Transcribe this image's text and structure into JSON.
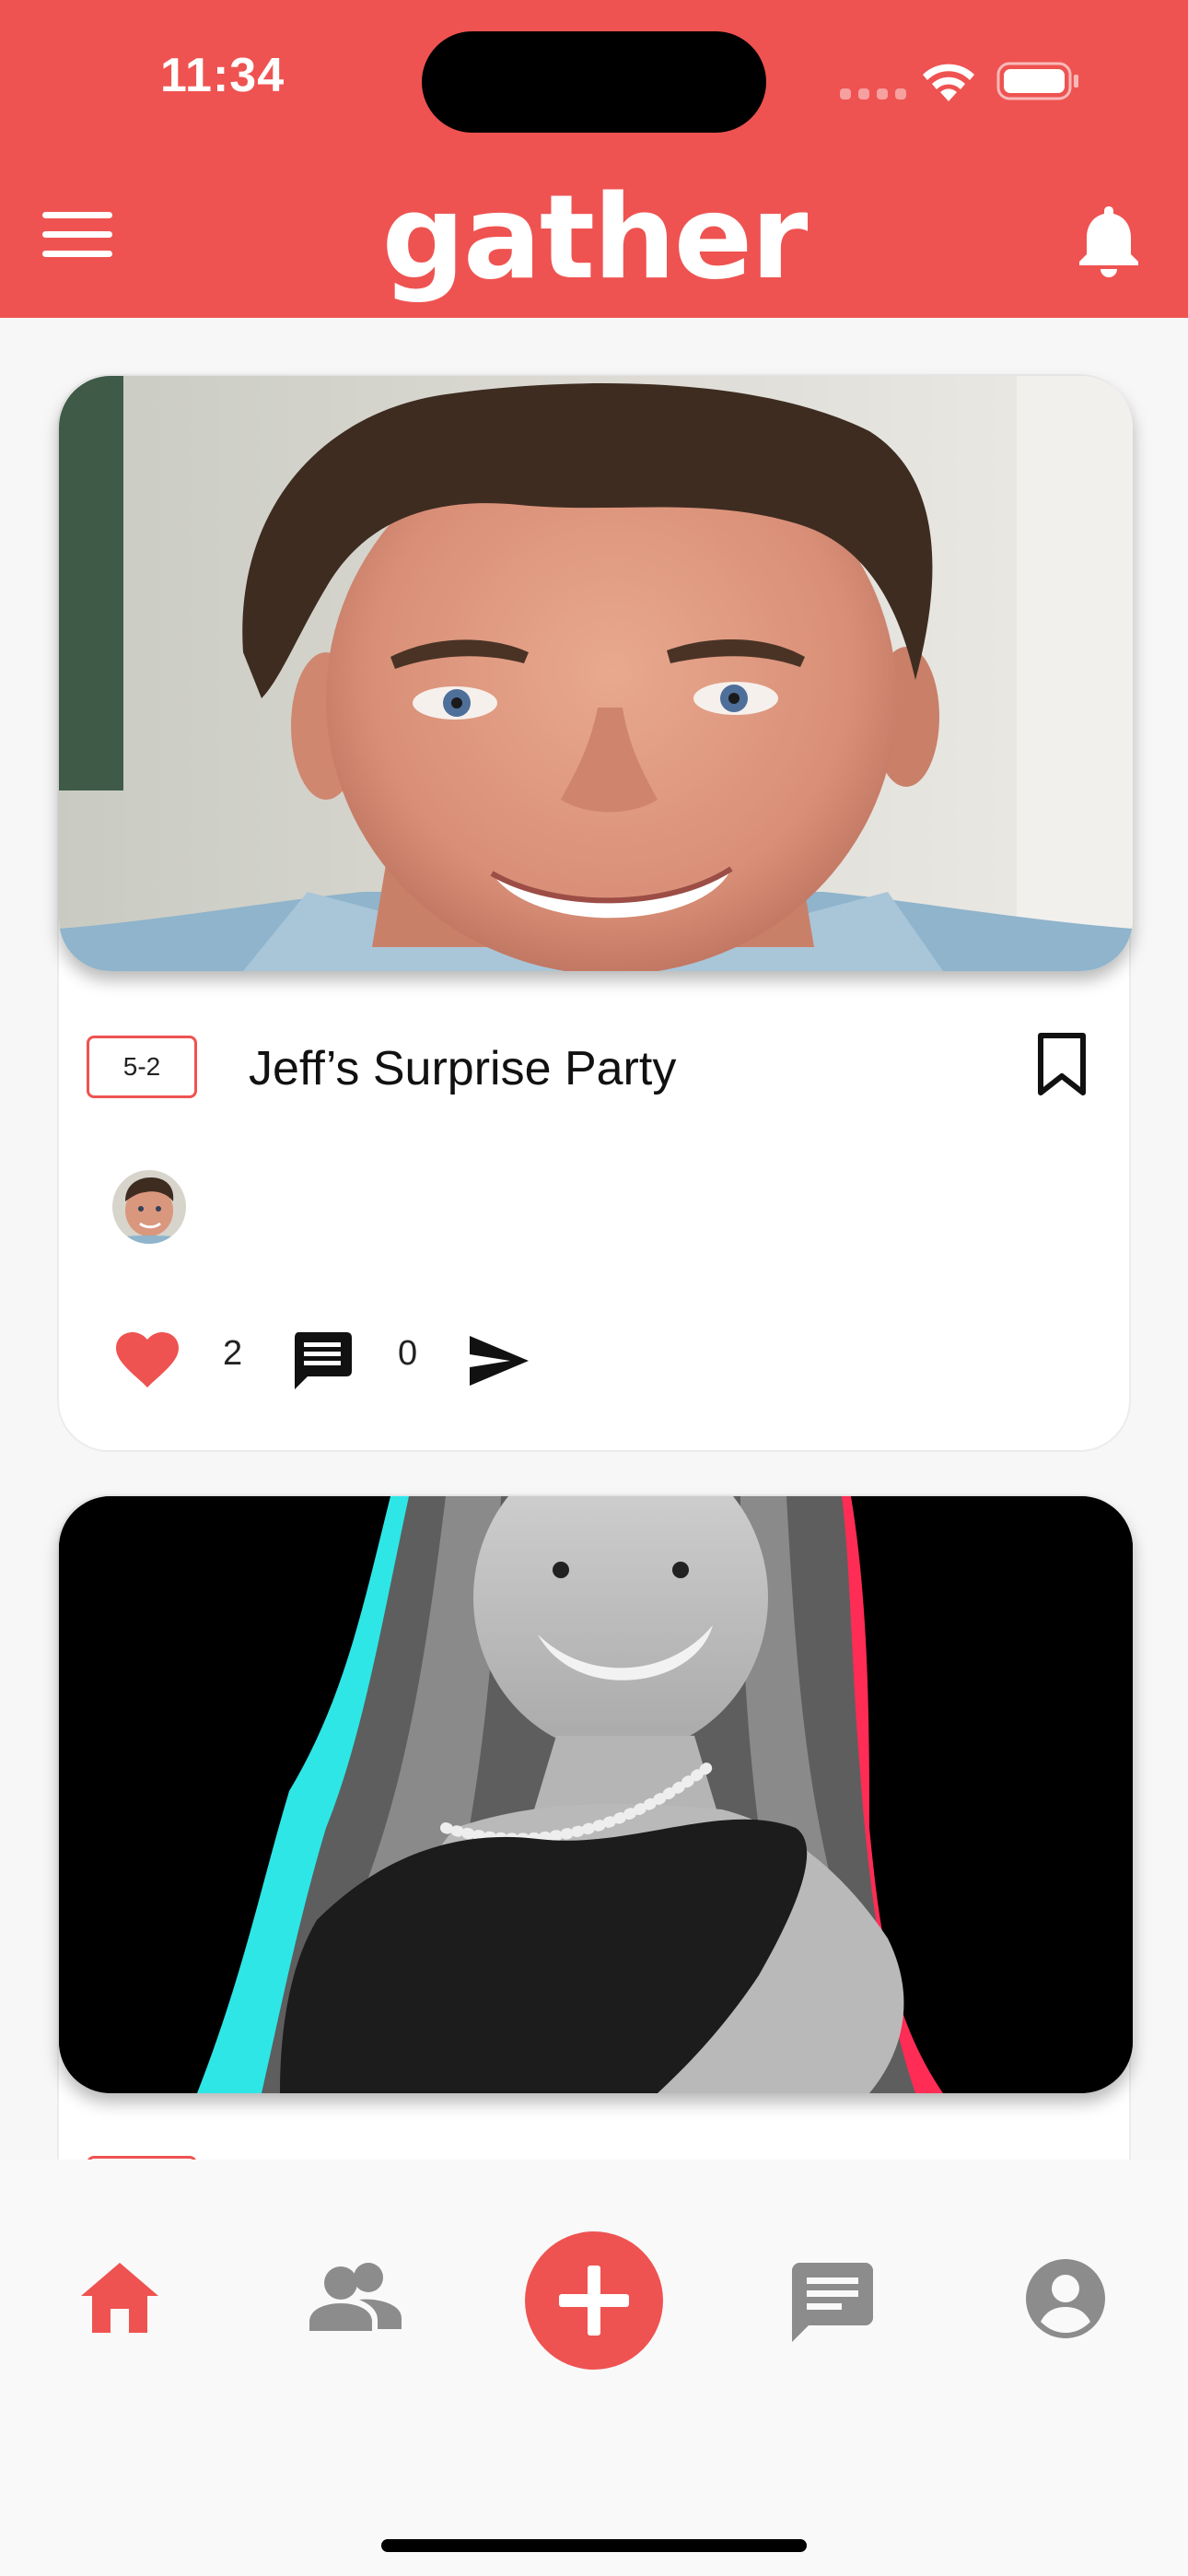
{
  "status_bar": {
    "time": "11:34"
  },
  "header": {
    "app_name": "gather",
    "menu_icon": "hamburger-menu-icon",
    "notification_icon": "bell-icon"
  },
  "colors": {
    "brand": "#ee5351",
    "active_nav": "#ee5351",
    "inactive_nav": "#8c8c8c"
  },
  "feed": {
    "events": [
      {
        "date": "5-2",
        "title": "Jeff’s Surprise Party",
        "bookmarked": false,
        "like_count": "2",
        "comment_count": "0",
        "image_subject": "smiling man portrait",
        "attendees": 1
      },
      {
        "image_subject": "girl in black dress portrait"
      }
    ]
  },
  "bottom_nav": {
    "items": [
      {
        "name": "home",
        "icon": "home-icon",
        "active": true
      },
      {
        "name": "friends",
        "icon": "people-icon",
        "active": false
      },
      {
        "name": "create",
        "icon": "plus-icon",
        "active": false
      },
      {
        "name": "messages",
        "icon": "chat-icon",
        "active": false
      },
      {
        "name": "profile",
        "icon": "account-circle-icon",
        "active": false
      }
    ]
  }
}
